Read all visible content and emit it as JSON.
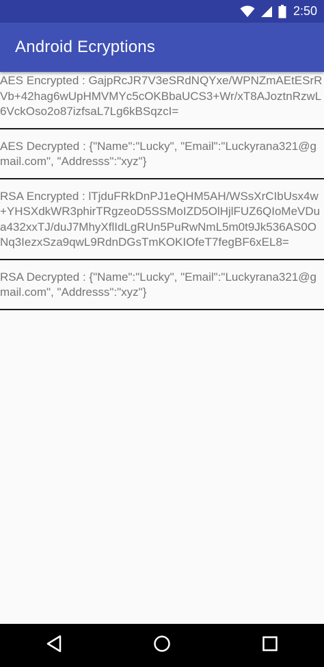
{
  "status_bar": {
    "time": "2:50",
    "icons": [
      "wifi-icon",
      "cell-signal-icon",
      "battery-icon"
    ]
  },
  "app_bar": {
    "title": "Android Ecryptions"
  },
  "entries": [
    {
      "id": "aes-encrypted",
      "text": "AES Encrypted : GajpRcJR7V3eSRdNQYxe/WPNZmAEtESrRVb+42hag6wUpHMVMYc5cOKBbaUCS3+Wr/xT8AJoztnRzwL6VckOso2o87izfsaL7Lg6kBSqzcI="
    },
    {
      "id": "aes-decrypted",
      "text": "AES Decrypted : {\"Name\":\"Lucky\", \"Email\":\"Luckyrana321@gmail.com\", \"Addresss\":\"xyz\"}"
    },
    {
      "id": "rsa-encrypted",
      "text": "RSA Encrypted : lTjduFRkDnPJ1eQHM5AH/WSsXrCIbUsx4w+YHSXdkWR3phirTRgzeoD5SSMoIZD5OlHjlFUZ6QIoMeVDua432xxTJ/duJ7MhyXflIdLgRUn5PuRwNmL5m0t9Jk536AS0ONq3IezxSza9qwL9RdnDGsTmKOKIOfeT7fegBF6xEL8="
    },
    {
      "id": "rsa-decrypted",
      "text": "RSA Decrypted : {\"Name\":\"Lucky\", \"Email\":\"Luckyrana321@gmail.com\", \"Addresss\":\"xyz\"}"
    }
  ],
  "nav_bar": {
    "buttons": [
      "back-icon",
      "home-icon",
      "recents-icon"
    ]
  },
  "colors": {
    "status_bar": "#303f9f",
    "app_bar": "#3f51b5",
    "text": "#757575",
    "background": "#fafafa",
    "divider": "#1a1a1a",
    "nav_bar": "#000000"
  }
}
